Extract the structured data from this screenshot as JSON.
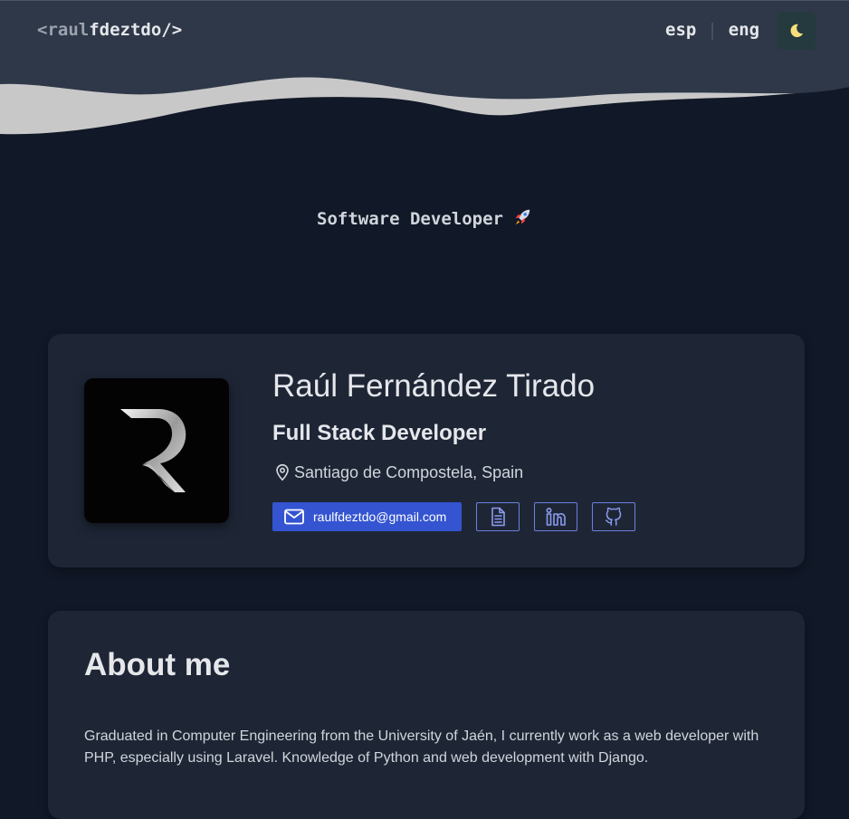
{
  "header": {
    "logo": {
      "open": "<",
      "prefix": "raul",
      "name": "fdeztdo",
      "close": "/>"
    },
    "languages": [
      "esp",
      "eng"
    ],
    "separator": "|",
    "theme_icon": "moon-icon"
  },
  "hero": {
    "tagline": "Software Developer",
    "tagline_icon": "rocket-icon"
  },
  "profile": {
    "name": "Raúl Fernández Tirado",
    "role": "Full Stack Developer",
    "location": "Santiago de Compostela, Spain",
    "location_icon": "map-pin-icon",
    "avatar_icon": "r-logo-icon",
    "email": "raulfdeztdo@gmail.com",
    "email_icon": "mail-icon",
    "link_icons": [
      "document-icon",
      "linkedin-icon",
      "github-icon"
    ]
  },
  "about": {
    "title": "About me",
    "text": "Graduated in Computer Engineering from the University of Jaén, I currently work as a web developer with PHP, especially using Laravel. Knowledge of Python and web development with Django."
  },
  "colors": {
    "background": "#111827",
    "header": "#2e3848",
    "wave": "#c8c8c8",
    "card": "#1e2636",
    "accent": "#3454d1",
    "moon": "#f5e07a"
  }
}
